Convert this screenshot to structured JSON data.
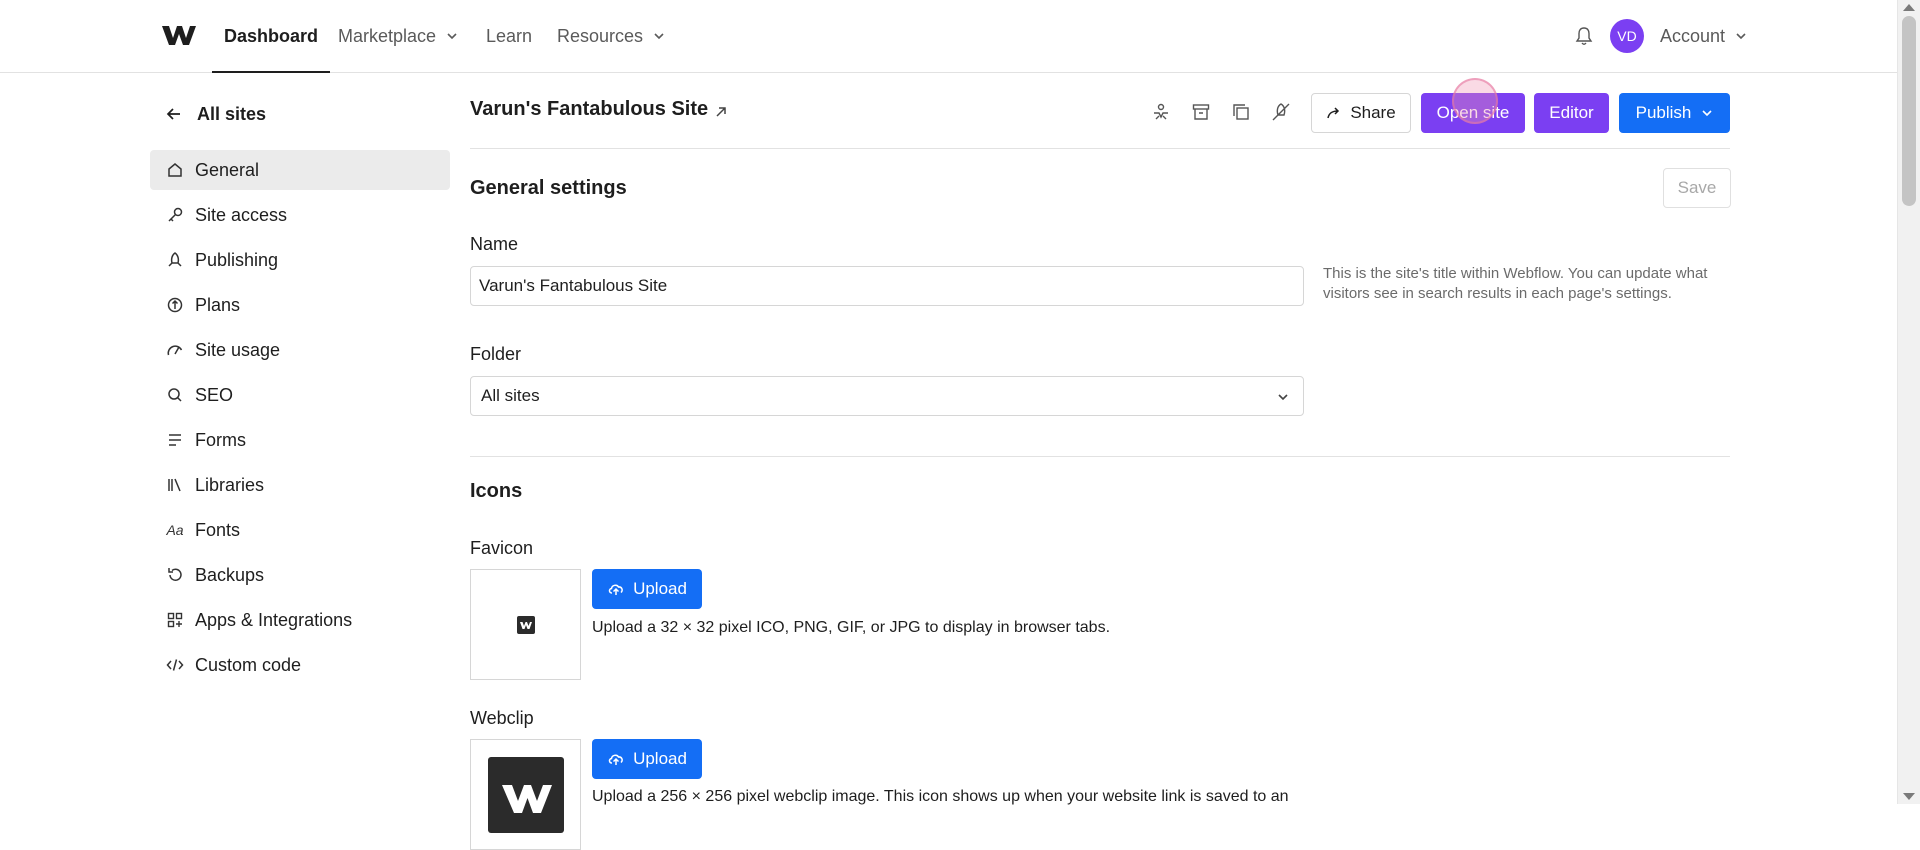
{
  "nav": {
    "items": [
      {
        "label": "Dashboard",
        "active": true
      },
      {
        "label": "Marketplace",
        "has_dropdown": true
      },
      {
        "label": "Learn"
      },
      {
        "label": "Resources",
        "has_dropdown": true
      }
    ],
    "avatar_initials": "VD",
    "account_label": "Account"
  },
  "sidebar": {
    "back_label": "All sites",
    "items": [
      {
        "label": "General",
        "icon": "home-icon",
        "active": true
      },
      {
        "label": "Site access",
        "icon": "key-icon"
      },
      {
        "label": "Publishing",
        "icon": "rocket-icon"
      },
      {
        "label": "Plans",
        "icon": "plans-icon"
      },
      {
        "label": "Site usage",
        "icon": "gauge-icon"
      },
      {
        "label": "SEO",
        "icon": "search-icon"
      },
      {
        "label": "Forms",
        "icon": "forms-icon"
      },
      {
        "label": "Libraries",
        "icon": "libraries-icon"
      },
      {
        "label": "Fonts",
        "icon": "fonts-icon"
      },
      {
        "label": "Backups",
        "icon": "backups-icon"
      },
      {
        "label": "Apps & Integrations",
        "icon": "apps-icon"
      },
      {
        "label": "Custom code",
        "icon": "code-icon"
      }
    ],
    "fonts_icon_glyph": "Aa"
  },
  "header": {
    "site_title": "Varun's Fantabulous Site",
    "share_label": "Share",
    "open_site_label": "Open site",
    "editor_label": "Editor",
    "publish_label": "Publish"
  },
  "general": {
    "title": "General settings",
    "save_label": "Save",
    "name_label": "Name",
    "name_value": "Varun's Fantabulous Site",
    "name_help": "This is the site's title within Webflow. You can update what visitors see in search results in each page's settings.",
    "folder_label": "Folder",
    "folder_value": "All sites"
  },
  "icons": {
    "title": "Icons",
    "favicon_label": "Favicon",
    "favicon_upload_label": "Upload",
    "favicon_desc": "Upload a 32 × 32 pixel ICO, PNG, GIF, or JPG to display in browser tabs.",
    "webclip_label": "Webclip",
    "webclip_upload_label": "Upload",
    "webclip_desc": "Upload a 256 × 256 pixel webclip image. This icon shows up when your website link is saved to an"
  },
  "colors": {
    "accent_purple": "#7b3ff2",
    "accent_blue": "#146ef5",
    "active_bg": "#ebebeb"
  }
}
